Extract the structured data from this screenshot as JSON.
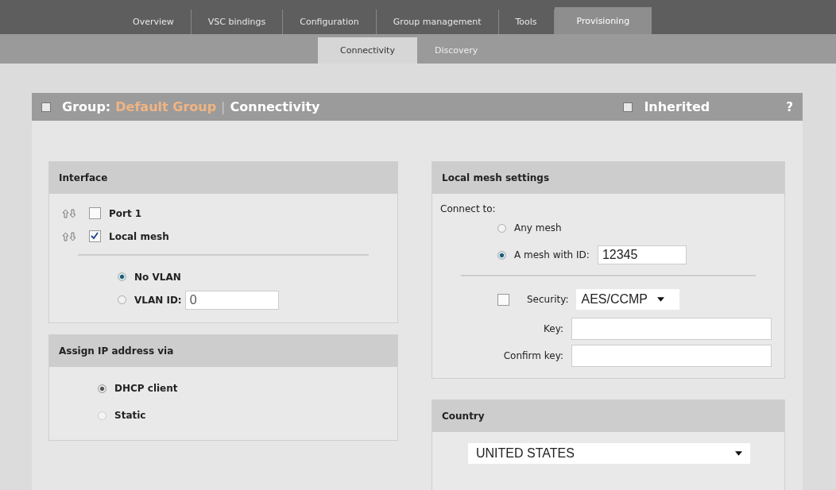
{
  "tabs": [
    {
      "label": "Overview",
      "selected": false
    },
    {
      "label": "VSC bindings",
      "selected": false
    },
    {
      "label": "Configuration",
      "selected": false
    },
    {
      "label": "Group management",
      "selected": false
    },
    {
      "label": "Tools",
      "selected": false
    },
    {
      "label": "Provisioning",
      "selected": true
    }
  ],
  "subtabs": [
    {
      "label": "Connectivity",
      "selected": true
    },
    {
      "label": "Discovery",
      "selected": false
    }
  ],
  "panel": {
    "checked": false,
    "group_label": "Group:",
    "group_name": "Default Group",
    "separator": "|",
    "title": "Connectivity",
    "inherited": {
      "label": "Inherited",
      "checked": false
    },
    "help": "?"
  },
  "interface": {
    "title": "Interface",
    "ports": [
      {
        "label": "Port 1",
        "checked": false
      },
      {
        "label": "Local mesh",
        "checked": true
      }
    ],
    "vlan": [
      {
        "label": "No VLAN",
        "selected": true
      },
      {
        "label": "VLAN ID:",
        "selected": false,
        "value": "0"
      }
    ]
  },
  "assign_ip": {
    "title": "Assign IP address via",
    "disabled": true,
    "options": [
      {
        "label": "DHCP client",
        "selected": true
      },
      {
        "label": "Static",
        "selected": false
      }
    ]
  },
  "mesh": {
    "title": "Local mesh settings",
    "connect_label": "Connect to:",
    "options": [
      {
        "label": "Any mesh",
        "selected": false
      },
      {
        "label": "A mesh with ID:",
        "selected": true,
        "value": "12345"
      }
    ],
    "security": {
      "checked": false,
      "label": "Security:",
      "value": "AES/CCMP"
    },
    "key": {
      "label": "Key:"
    },
    "confirm_key": {
      "label": "Confirm key:"
    }
  },
  "country": {
    "title": "Country",
    "value": "UNITED STATES"
  }
}
